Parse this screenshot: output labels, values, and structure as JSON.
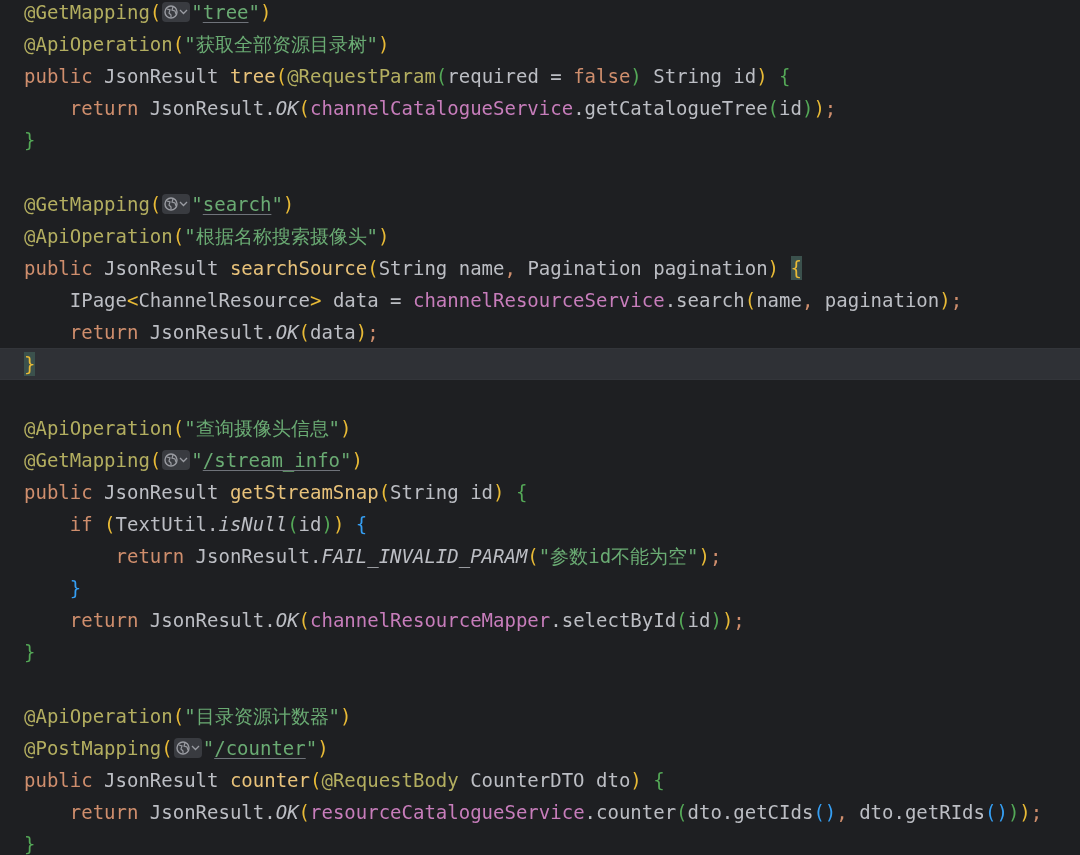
{
  "editor": {
    "lines": [
      {
        "current": false,
        "tokens": [
          {
            "text": "@GetMapping",
            "kind": "annotation"
          },
          {
            "text": "(",
            "kind": "paren1"
          },
          {
            "kind": "hint"
          },
          {
            "text": "\"",
            "kind": "string"
          },
          {
            "text": "tree",
            "kind": "link"
          },
          {
            "text": "\"",
            "kind": "string"
          },
          {
            "text": ")",
            "kind": "paren1"
          }
        ]
      },
      {
        "current": false,
        "tokens": [
          {
            "text": "@ApiOperation",
            "kind": "annotation"
          },
          {
            "text": "(",
            "kind": "paren1"
          },
          {
            "text": "\"获取全部资源目录树\"",
            "kind": "string"
          },
          {
            "text": ")",
            "kind": "paren1"
          }
        ]
      },
      {
        "current": false,
        "tokens": [
          {
            "text": "public ",
            "kind": "keyword"
          },
          {
            "text": "JsonResult ",
            "kind": "plain"
          },
          {
            "text": "tree",
            "kind": "method"
          },
          {
            "text": "(",
            "kind": "paren1"
          },
          {
            "text": "@RequestParam",
            "kind": "annotation"
          },
          {
            "text": "(",
            "kind": "paren2"
          },
          {
            "text": "required = ",
            "kind": "plain"
          },
          {
            "text": "false",
            "kind": "keyword"
          },
          {
            "text": ")",
            "kind": "paren2"
          },
          {
            "text": " String id",
            "kind": "plain"
          },
          {
            "text": ")",
            "kind": "paren1"
          },
          {
            "text": " {",
            "kind": "paren2"
          }
        ]
      },
      {
        "current": false,
        "tokens": [
          {
            "text": "    return ",
            "kind": "keyword"
          },
          {
            "text": "JsonResult.",
            "kind": "plain"
          },
          {
            "text": "OK",
            "kind": "static"
          },
          {
            "text": "(",
            "kind": "paren1"
          },
          {
            "text": "channelCatalogueService",
            "kind": "field"
          },
          {
            "text": ".getCatalogueTree",
            "kind": "plain"
          },
          {
            "text": "(",
            "kind": "paren2"
          },
          {
            "text": "id",
            "kind": "plain"
          },
          {
            "text": ")",
            "kind": "paren2"
          },
          {
            "text": ")",
            "kind": "paren1"
          },
          {
            "text": ";",
            "kind": "punct"
          }
        ]
      },
      {
        "current": false,
        "tokens": [
          {
            "text": "}",
            "kind": "paren2"
          }
        ]
      },
      {
        "current": false
      },
      {
        "current": false,
        "tokens": [
          {
            "text": "@GetMapping",
            "kind": "annotation"
          },
          {
            "text": "(",
            "kind": "paren1"
          },
          {
            "kind": "hint"
          },
          {
            "text": "\"",
            "kind": "string"
          },
          {
            "text": "search",
            "kind": "link"
          },
          {
            "text": "\"",
            "kind": "string"
          },
          {
            "text": ")",
            "kind": "paren1"
          }
        ]
      },
      {
        "current": false,
        "tokens": [
          {
            "text": "@ApiOperation",
            "kind": "annotation"
          },
          {
            "text": "(",
            "kind": "paren1"
          },
          {
            "text": "\"根据名称搜索摄像头\"",
            "kind": "string"
          },
          {
            "text": ")",
            "kind": "paren1"
          }
        ]
      },
      {
        "current": false,
        "tokens": [
          {
            "text": "public ",
            "kind": "keyword"
          },
          {
            "text": "JsonResult ",
            "kind": "plain"
          },
          {
            "text": "searchSource",
            "kind": "method"
          },
          {
            "text": "(",
            "kind": "paren1"
          },
          {
            "text": "String name",
            "kind": "plain"
          },
          {
            "text": ", ",
            "kind": "punct"
          },
          {
            "text": "Pagination pagination",
            "kind": "plain"
          },
          {
            "text": ") ",
            "kind": "paren1"
          },
          {
            "text": "{",
            "kind": "paren1",
            "matched": true
          }
        ]
      },
      {
        "current": false,
        "tokens": [
          {
            "text": "    IPage",
            "kind": "plain"
          },
          {
            "text": "<",
            "kind": "paren1"
          },
          {
            "text": "ChannelResource",
            "kind": "plain"
          },
          {
            "text": ">",
            "kind": "paren1"
          },
          {
            "text": " data = ",
            "kind": "plain"
          },
          {
            "text": "channelResourceService",
            "kind": "field"
          },
          {
            "text": ".search",
            "kind": "plain"
          },
          {
            "text": "(",
            "kind": "paren1"
          },
          {
            "text": "name",
            "kind": "plain"
          },
          {
            "text": ", ",
            "kind": "punct"
          },
          {
            "text": "pagination",
            "kind": "plain"
          },
          {
            "text": ")",
            "kind": "paren1"
          },
          {
            "text": ";",
            "kind": "punct"
          }
        ]
      },
      {
        "current": false,
        "tokens": [
          {
            "text": "    return ",
            "kind": "keyword"
          },
          {
            "text": "JsonResult.",
            "kind": "plain"
          },
          {
            "text": "OK",
            "kind": "static"
          },
          {
            "text": "(",
            "kind": "paren1"
          },
          {
            "text": "data",
            "kind": "plain"
          },
          {
            "text": ")",
            "kind": "paren1"
          },
          {
            "text": ";",
            "kind": "punct"
          }
        ]
      },
      {
        "current": true,
        "tokens": [
          {
            "text": "}",
            "kind": "paren1",
            "matched": true
          }
        ]
      },
      {
        "current": false
      },
      {
        "current": false,
        "tokens": [
          {
            "text": "@ApiOperation",
            "kind": "annotation"
          },
          {
            "text": "(",
            "kind": "paren1"
          },
          {
            "text": "\"查询摄像头信息\"",
            "kind": "string"
          },
          {
            "text": ")",
            "kind": "paren1"
          }
        ]
      },
      {
        "current": false,
        "tokens": [
          {
            "text": "@GetMapping",
            "kind": "annotation"
          },
          {
            "text": "(",
            "kind": "paren1"
          },
          {
            "kind": "hint"
          },
          {
            "text": "\"",
            "kind": "string"
          },
          {
            "text": "/stream_info",
            "kind": "link"
          },
          {
            "text": "\"",
            "kind": "string"
          },
          {
            "text": ")",
            "kind": "paren1"
          }
        ]
      },
      {
        "current": false,
        "tokens": [
          {
            "text": "public ",
            "kind": "keyword"
          },
          {
            "text": "JsonResult ",
            "kind": "plain"
          },
          {
            "text": "getStreamSnap",
            "kind": "method"
          },
          {
            "text": "(",
            "kind": "paren1"
          },
          {
            "text": "String id",
            "kind": "plain"
          },
          {
            "text": ")",
            "kind": "paren1"
          },
          {
            "text": " {",
            "kind": "paren2"
          }
        ]
      },
      {
        "current": false,
        "tokens": [
          {
            "text": "    if ",
            "kind": "keyword"
          },
          {
            "text": "(",
            "kind": "paren1"
          },
          {
            "text": "TextUtil.",
            "kind": "plain"
          },
          {
            "text": "isNull",
            "kind": "static"
          },
          {
            "text": "(",
            "kind": "paren2"
          },
          {
            "text": "id",
            "kind": "plain"
          },
          {
            "text": ")",
            "kind": "paren2"
          },
          {
            "text": ")",
            "kind": "paren1"
          },
          {
            "text": " {",
            "kind": "paren3"
          }
        ]
      },
      {
        "current": false,
        "tokens": [
          {
            "text": "        return ",
            "kind": "keyword"
          },
          {
            "text": "JsonResult.",
            "kind": "plain"
          },
          {
            "text": "FAIL_INVALID_PARAM",
            "kind": "static"
          },
          {
            "text": "(",
            "kind": "paren1"
          },
          {
            "text": "\"参数id不能为空\"",
            "kind": "string"
          },
          {
            "text": ")",
            "kind": "paren1"
          },
          {
            "text": ";",
            "kind": "punct"
          }
        ]
      },
      {
        "current": false,
        "tokens": [
          {
            "text": "    }",
            "kind": "paren3"
          }
        ]
      },
      {
        "current": false,
        "tokens": [
          {
            "text": "    return ",
            "kind": "keyword"
          },
          {
            "text": "JsonResult.",
            "kind": "plain"
          },
          {
            "text": "OK",
            "kind": "static"
          },
          {
            "text": "(",
            "kind": "paren1"
          },
          {
            "text": "channelResourceMapper",
            "kind": "field"
          },
          {
            "text": ".selectById",
            "kind": "plain"
          },
          {
            "text": "(",
            "kind": "paren2"
          },
          {
            "text": "id",
            "kind": "plain"
          },
          {
            "text": ")",
            "kind": "paren2"
          },
          {
            "text": ")",
            "kind": "paren1"
          },
          {
            "text": ";",
            "kind": "punct"
          }
        ]
      },
      {
        "current": false,
        "tokens": [
          {
            "text": "}",
            "kind": "paren2"
          }
        ]
      },
      {
        "current": false
      },
      {
        "current": false,
        "tokens": [
          {
            "text": "@ApiOperation",
            "kind": "annotation"
          },
          {
            "text": "(",
            "kind": "paren1"
          },
          {
            "text": "\"目录资源计数器\"",
            "kind": "string"
          },
          {
            "text": ")",
            "kind": "paren1"
          }
        ]
      },
      {
        "current": false,
        "tokens": [
          {
            "text": "@PostMapping",
            "kind": "annotation"
          },
          {
            "text": "(",
            "kind": "paren1"
          },
          {
            "kind": "hint"
          },
          {
            "text": "\"",
            "kind": "string"
          },
          {
            "text": "/counter",
            "kind": "link"
          },
          {
            "text": "\"",
            "kind": "string"
          },
          {
            "text": ")",
            "kind": "paren1"
          }
        ]
      },
      {
        "current": false,
        "tokens": [
          {
            "text": "public ",
            "kind": "keyword"
          },
          {
            "text": "JsonResult ",
            "kind": "plain"
          },
          {
            "text": "counter",
            "kind": "method"
          },
          {
            "text": "(",
            "kind": "paren1"
          },
          {
            "text": "@RequestBody",
            "kind": "annotation"
          },
          {
            "text": " CounterDTO dto",
            "kind": "plain"
          },
          {
            "text": ")",
            "kind": "paren1"
          },
          {
            "text": " {",
            "kind": "paren2"
          }
        ]
      },
      {
        "current": false,
        "tokens": [
          {
            "text": "    return ",
            "kind": "keyword"
          },
          {
            "text": "JsonResult.",
            "kind": "plain"
          },
          {
            "text": "OK",
            "kind": "static"
          },
          {
            "text": "(",
            "kind": "paren1"
          },
          {
            "text": "resourceCatalogueService",
            "kind": "field"
          },
          {
            "text": ".counter",
            "kind": "plain"
          },
          {
            "text": "(",
            "kind": "paren2"
          },
          {
            "text": "dto.getCIds",
            "kind": "plain"
          },
          {
            "text": "()",
            "kind": "paren3"
          },
          {
            "text": ", ",
            "kind": "punct"
          },
          {
            "text": "dto.getRIds",
            "kind": "plain"
          },
          {
            "text": "()",
            "kind": "paren3"
          },
          {
            "text": ")",
            "kind": "paren2"
          },
          {
            "text": ")",
            "kind": "paren1"
          },
          {
            "text": ";",
            "kind": "punct"
          }
        ]
      },
      {
        "current": false,
        "tokens": [
          {
            "text": "}",
            "kind": "paren2"
          }
        ]
      }
    ]
  }
}
